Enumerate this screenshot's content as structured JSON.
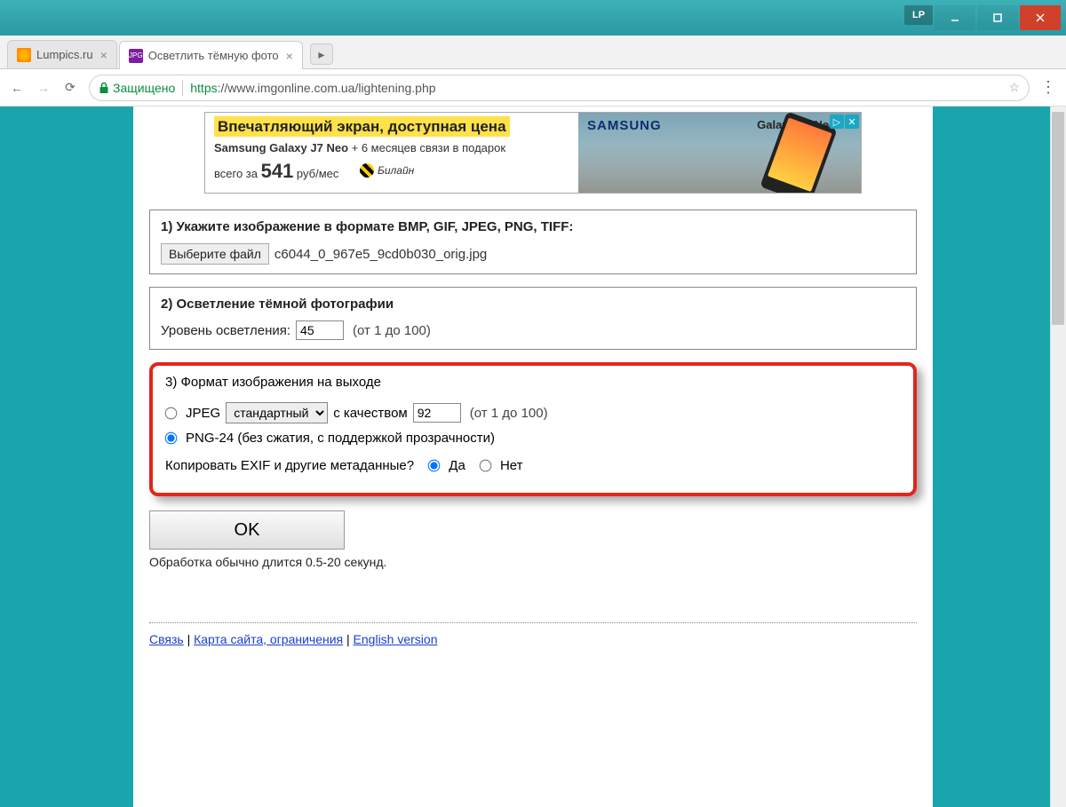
{
  "window": {
    "lp_badge": "LP"
  },
  "tabs": [
    {
      "label": "Lumpics.ru",
      "active": false
    },
    {
      "label": "Осветлить тёмную фото",
      "active": true
    }
  ],
  "addressbar": {
    "secure_label": "Защищено",
    "url_https": "https",
    "url_rest": "://www.imgonline.com.ua/lightening.php"
  },
  "ad": {
    "title_pref": "Впечатляющий экран,",
    "title_hl": " доступная цена",
    "sub_bold": "Samsung Galaxy J7 Neo",
    "sub_rest": " + 6 месяцев связи в подарок",
    "price_pref": "всего за ",
    "price": "541",
    "price_suf": " руб/мес",
    "bee": "Билайн",
    "samsung": "SAMSUNG",
    "model": "Galaxy J7 Neo"
  },
  "step1": {
    "title": "1) Укажите изображение в формате BMP, GIF, JPEG, PNG, TIFF:",
    "button": "Выберите файл",
    "filename": "c6044_0_967e5_9cd0b030_orig.jpg"
  },
  "step2": {
    "title": "2) Осветление тёмной фотографии",
    "level_label": "Уровень осветления:",
    "level_value": "45",
    "level_hint": "(от 1 до 100)"
  },
  "step3": {
    "title": "3) Формат изображения на выходе",
    "jpeg_label": "JPEG",
    "jpeg_mode": "стандартный",
    "quality_label": " с качеством ",
    "quality_value": "92",
    "quality_hint": "(от 1 до 100)",
    "png_label": "PNG-24 (без сжатия, с поддержкой прозрачности)",
    "exif_label": "Копировать EXIF и другие метаданные?",
    "yes": "Да",
    "no": "Нет"
  },
  "submit": {
    "ok": "OK",
    "note": "Обработка обычно длится 0.5-20 секунд."
  },
  "footer": {
    "link1": "Связь",
    "link2": "Карта сайта, ограничения",
    "link3": "English version",
    "sep": " | "
  }
}
